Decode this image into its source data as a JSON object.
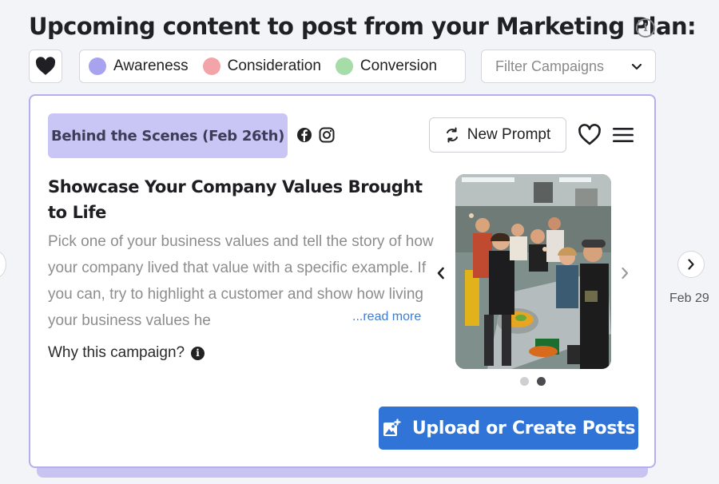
{
  "header": {
    "title": "Upcoming content to post from your Marketing Plan:",
    "info_icon": "info-icon"
  },
  "favorites_filter": {
    "icon": "heart-filled-icon"
  },
  "legend": {
    "items": [
      {
        "label": "Awareness",
        "color": "#a7a3ef"
      },
      {
        "label": "Consideration",
        "color": "#f3a4a8"
      },
      {
        "label": "Conversion",
        "color": "#a6dca8"
      }
    ]
  },
  "filter": {
    "placeholder": "Filter Campaigns",
    "icon": "chevron-down-icon"
  },
  "card": {
    "tag": "Behind the Scenes (Feb 26th)",
    "tag_color": "#c9c5f5",
    "platforms": [
      "facebook-icon",
      "instagram-icon"
    ],
    "new_prompt_label": "New Prompt",
    "headline": "Showcase Your Company Values Brought to Life",
    "description": "Pick one of your business values and tell the story of how your company lived that value with a specific example. If you can, try to highlight a customer and show how living your business values he",
    "read_more": "...read more",
    "why_label": "Why this campaign?",
    "image_alt": "Team cooking together in a kitchen",
    "carousel": {
      "total": 2,
      "active": 2
    },
    "upload_label": "Upload or Create Posts",
    "accent": "#2f74d6"
  },
  "next_nav": {
    "date": "Feb 29",
    "icon": "chevron-right-icon"
  }
}
